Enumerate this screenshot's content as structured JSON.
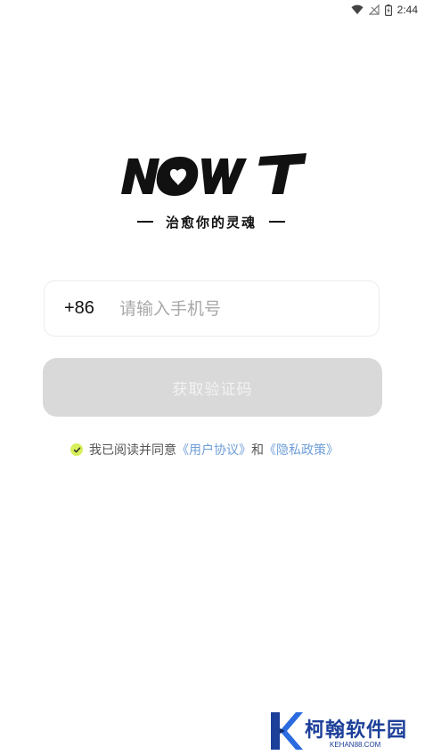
{
  "status_bar": {
    "time": "2:44",
    "icons": [
      "wifi-icon",
      "no-signal-icon",
      "battery-charging-icon"
    ]
  },
  "logo": {
    "text": "NOWT",
    "slogan": "治愈你的灵魂"
  },
  "phone": {
    "country_code": "+86",
    "placeholder": "请输入手机号",
    "value": ""
  },
  "code_button": {
    "label": "获取验证码"
  },
  "agreement": {
    "checked": true,
    "prefix": "我已阅读并同意",
    "user_agreement": "《用户协议》",
    "conjunction": "和",
    "privacy_policy": "《隐私政策》"
  },
  "watermark": {
    "name": "柯翰软件园",
    "domain": "KEHAN88.COM"
  },
  "colors": {
    "button_disabled": "#d9d9d9",
    "link": "#6f9ed8",
    "check": "#d7ef5a",
    "watermark": "#1c3f99"
  }
}
